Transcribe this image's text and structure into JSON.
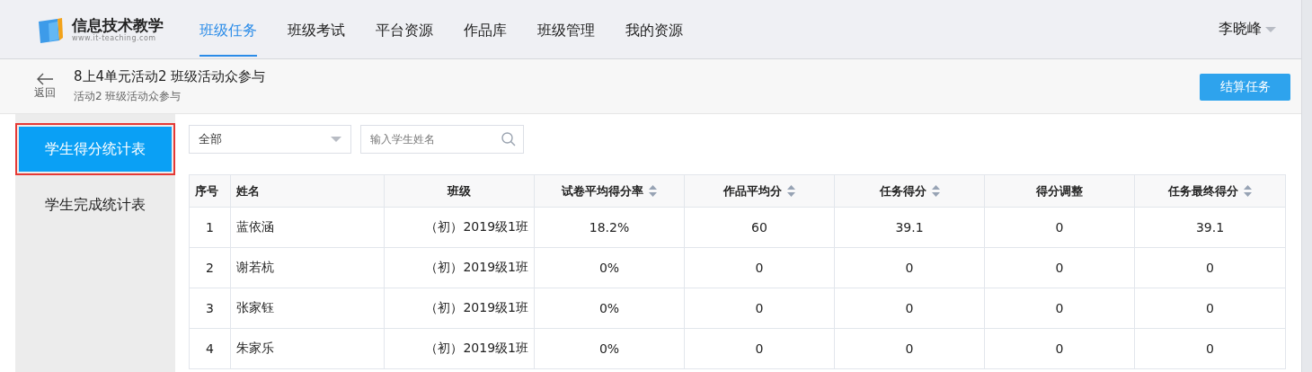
{
  "logo": {
    "title": "信息技术教学",
    "subtitle": "www.it-teaching.com"
  },
  "nav": [
    {
      "label": "班级任务",
      "selected": true
    },
    {
      "label": "班级考试",
      "selected": false
    },
    {
      "label": "平台资源",
      "selected": false
    },
    {
      "label": "作品库",
      "selected": false
    },
    {
      "label": "班级管理",
      "selected": false
    },
    {
      "label": "我的资源",
      "selected": false
    }
  ],
  "user": {
    "name": "李晓峰"
  },
  "header": {
    "back": "返回",
    "title": "8上4单元活动2 班级活动众参与",
    "subtitle": "活动2 班级活动众参与",
    "action": "结算任务"
  },
  "sidebar": {
    "items": [
      {
        "label": "学生得分统计表",
        "selected": true,
        "highlighted": true
      },
      {
        "label": "学生完成统计表",
        "selected": false,
        "highlighted": false
      }
    ]
  },
  "filter": {
    "value": "全部"
  },
  "search": {
    "placeholder": "输入学生姓名"
  },
  "table": {
    "columns": [
      {
        "label": "序号",
        "sortable": false
      },
      {
        "label": "姓名",
        "sortable": false
      },
      {
        "label": "班级",
        "sortable": false
      },
      {
        "label": "试卷平均得分率",
        "sortable": true
      },
      {
        "label": "作品平均分",
        "sortable": true
      },
      {
        "label": "任务得分",
        "sortable": true
      },
      {
        "label": "得分调整",
        "sortable": false
      },
      {
        "label": "任务最终得分",
        "sortable": true
      }
    ],
    "rows": [
      [
        "1",
        "蓝依涵",
        "（初）2019级1班",
        "18.2%",
        "60",
        "39.1",
        "0",
        "39.1"
      ],
      [
        "2",
        "谢若杭",
        "（初）2019级1班",
        "0%",
        "0",
        "0",
        "0",
        "0"
      ],
      [
        "3",
        "张家钰",
        "（初）2019级1班",
        "0%",
        "0",
        "0",
        "0",
        "0"
      ],
      [
        "4",
        "朱家乐",
        "（初）2019级1班",
        "0%",
        "0",
        "0",
        "0",
        "0"
      ]
    ]
  }
}
